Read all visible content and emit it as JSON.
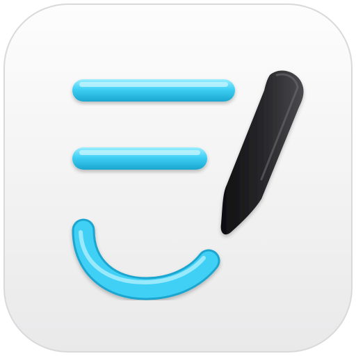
{
  "app_icon": {
    "icon_name": "notes-pen-app-icon",
    "colors": {
      "tile_top": "#fdfdfd",
      "tile_bottom": "#e9e9ea",
      "tile_border": "#d9d9db",
      "stroke_accent": "#3fd0f5",
      "stroke_highlight": "#a9f0ff",
      "stroke_shadow": "#1aa6cf",
      "pen_body": "#1c1c1e",
      "pen_highlight": "#5a5a5e"
    },
    "elements": [
      "line-stroke-top",
      "line-stroke-middle",
      "smile-arc",
      "pen"
    ]
  }
}
